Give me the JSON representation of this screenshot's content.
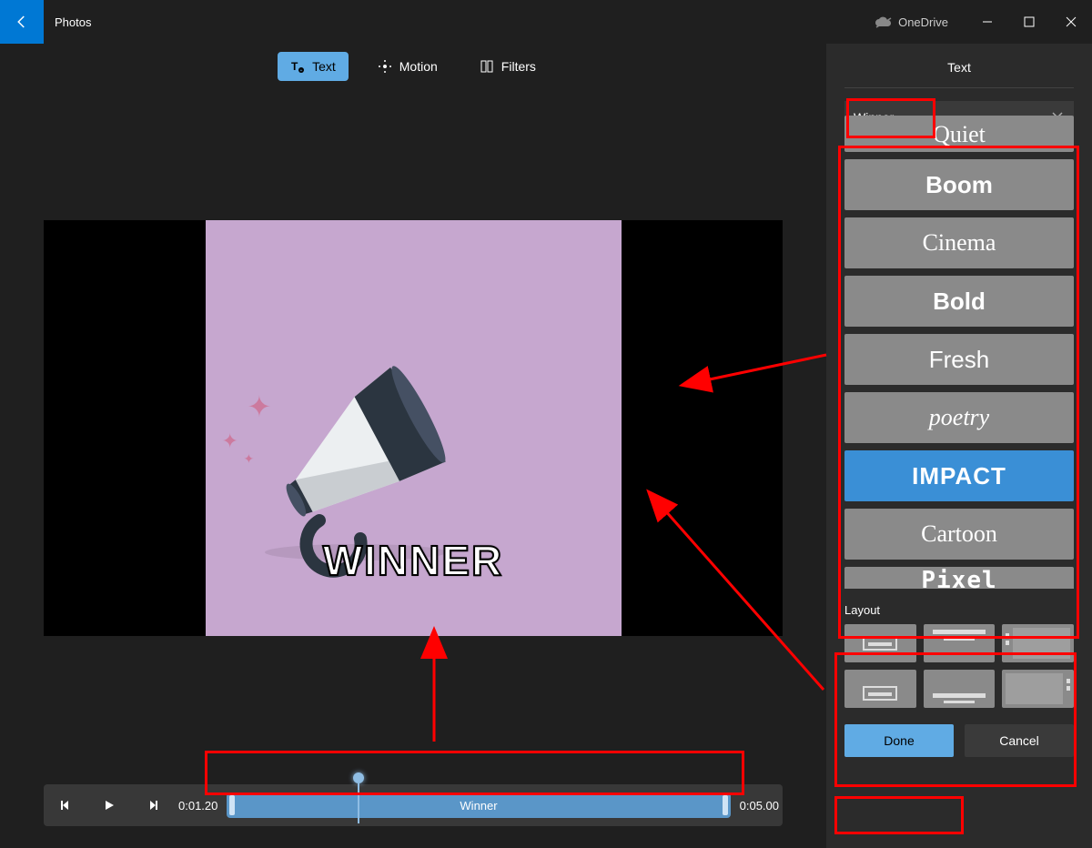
{
  "app_title": "Photos",
  "titlebar": {
    "onedrive_label": "OneDrive"
  },
  "tabs": {
    "text": "Text",
    "motion": "Motion",
    "filters": "Filters"
  },
  "preview": {
    "overlay_text": "WINNER"
  },
  "timeline": {
    "current_time": "0:01.20",
    "total_time": "0:05.00",
    "clip_label": "Winner"
  },
  "panel": {
    "title": "Text",
    "input_value": "Winner",
    "styles": {
      "quiet": "Quiet",
      "boom": "Boom",
      "cinema": "Cinema",
      "bold": "Bold",
      "fresh": "Fresh",
      "poetry": "poetry",
      "impact": "IMPACT",
      "cartoon": "Cartoon",
      "pixel": "Pixel"
    },
    "layout_label": "Layout",
    "done": "Done",
    "cancel": "Cancel"
  }
}
